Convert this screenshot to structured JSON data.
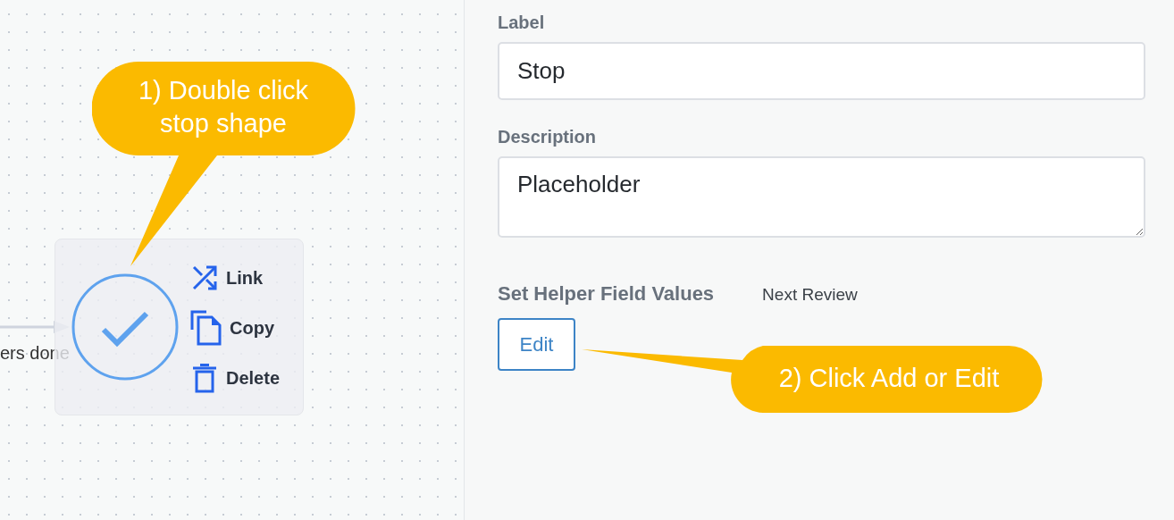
{
  "canvas": {
    "edge_label": "ers done",
    "node": {
      "kind": "stop"
    },
    "actions": [
      {
        "kind": "link",
        "label": "Link"
      },
      {
        "kind": "copy",
        "label": "Copy"
      },
      {
        "kind": "delete",
        "label": "Delete"
      }
    ]
  },
  "callouts": [
    {
      "lines": [
        "1) Double click",
        "stop shape"
      ]
    },
    {
      "lines": [
        "2) Click Add or Edit"
      ]
    }
  ],
  "panel": {
    "label_field": {
      "label": "Label",
      "value": "Stop"
    },
    "description_field": {
      "label": "Description",
      "value": "Placeholder"
    },
    "helper": {
      "label": "Set Helper Field Values",
      "field": "Next Review",
      "button": "Edit"
    }
  }
}
